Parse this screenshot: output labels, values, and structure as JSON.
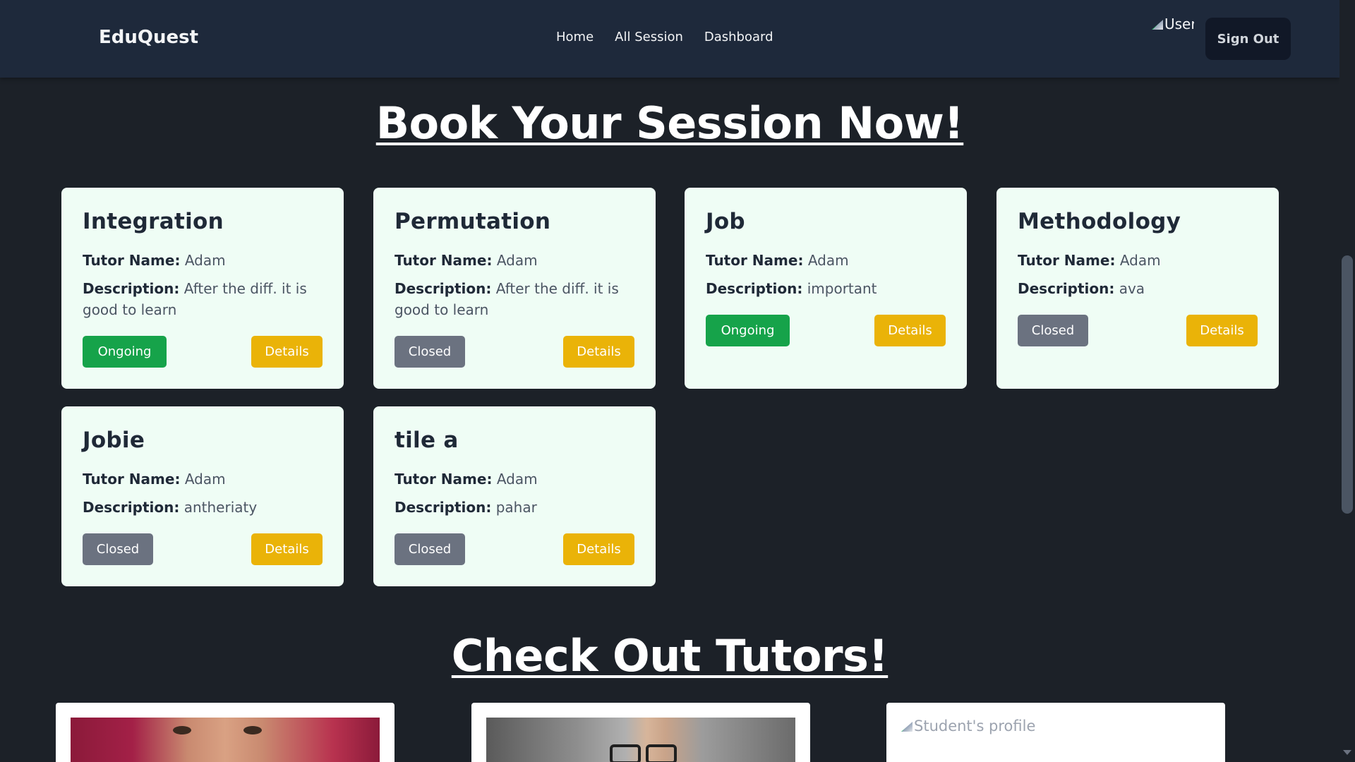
{
  "navbar": {
    "brand": "EduQuest",
    "links": [
      "Home",
      "All Session",
      "Dashboard"
    ],
    "user_image_alt": "User",
    "sign_out": "Sign Out"
  },
  "headings": {
    "book": "Book Your Session Now!",
    "tutors": "Check Out Tutors!"
  },
  "labels": {
    "tutor_name": "Tutor Name:",
    "description": "Description:",
    "details": "Details"
  },
  "sessions": [
    {
      "title": "Integration",
      "tutor": "Adam",
      "description": "After the diff. it is good to learn",
      "status": "Ongoing"
    },
    {
      "title": "Permutation",
      "tutor": "Adam",
      "description": "After the diff. it is good to learn",
      "status": "Closed"
    },
    {
      "title": "Job",
      "tutor": "Adam",
      "description": "important",
      "status": "Ongoing"
    },
    {
      "title": "Methodology",
      "tutor": "Adam",
      "description": "ava",
      "status": "Closed"
    },
    {
      "title": "Jobie",
      "tutor": "Adam",
      "description": "antheriaty",
      "status": "Closed"
    },
    {
      "title": "tile a",
      "tutor": "Adam",
      "description": "pahar",
      "status": "Closed"
    }
  ],
  "tutors": [
    {
      "image": "tutor-photo"
    },
    {
      "image": "tutor-photo"
    },
    {
      "image_alt": "Student's profile"
    }
  ],
  "colors": {
    "background": "#1c2128",
    "navbar": "#1e293b",
    "card": "#effdf5",
    "ongoing": "#16a34a",
    "closed": "#6b7280",
    "details": "#eab308"
  }
}
